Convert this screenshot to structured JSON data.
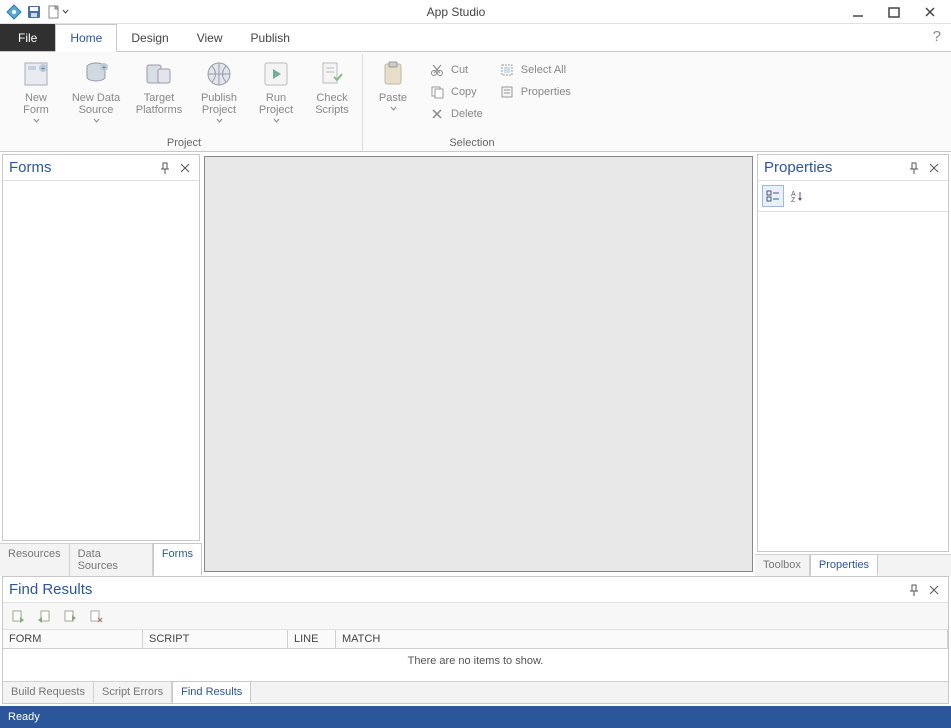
{
  "app": {
    "title": "App Studio"
  },
  "ribbon": {
    "tabs": {
      "file": "File",
      "home": "Home",
      "design": "Design",
      "view": "View",
      "publish": "Publish"
    },
    "groups": {
      "project": {
        "label": "Project",
        "new_form": "New\nForm",
        "new_data_source": "New Data\nSource",
        "target_platforms": "Target\nPlatforms",
        "publish_project": "Publish\nProject",
        "run_project": "Run\nProject",
        "check_scripts": "Check\nScripts"
      },
      "clipboard": {
        "paste": "Paste"
      },
      "edit": {
        "cut": "Cut",
        "copy": "Copy",
        "delete": "Delete"
      },
      "selection": {
        "label": "Selection",
        "select_all": "Select All",
        "properties": "Properties"
      }
    }
  },
  "panels": {
    "forms": {
      "title": "Forms",
      "tabs": {
        "resources": "Resources",
        "data_sources": "Data Sources",
        "forms": "Forms"
      }
    },
    "properties": {
      "title": "Properties",
      "tabs": {
        "toolbox": "Toolbox",
        "properties": "Properties"
      }
    }
  },
  "find_results": {
    "title": "Find Results",
    "columns": {
      "form": "FORM",
      "script": "SCRIPT",
      "line": "LINE",
      "match": "MATCH"
    },
    "empty": "There are no items to show.",
    "tabs": {
      "build": "Build Requests",
      "errors": "Script Errors",
      "find": "Find Results"
    }
  },
  "status": {
    "text": "Ready"
  }
}
